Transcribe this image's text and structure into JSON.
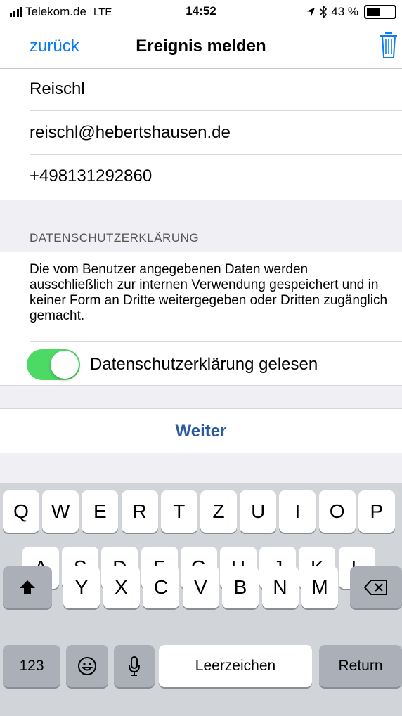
{
  "status_bar": {
    "carrier": "Telekom.de",
    "network": "LTE",
    "time": "14:52",
    "battery": "43 %",
    "battery_fraction": 0.43
  },
  "nav": {
    "back_label": "zurück",
    "title": "Ereignis melden"
  },
  "fields": {
    "name": "Reischl",
    "email": "reischl@hebertshausen.de",
    "phone": "+498131292860"
  },
  "privacy": {
    "header": "DATENSCHUTZERKLÄRUNG",
    "text": "Die vom Benutzer angegebenen Daten werden ausschließlich zur internen Verwendung gespeichert und in keiner Form an Dritte weitergegeben oder Dritten zugänglich gemacht.",
    "toggle_label": "Datenschutzerklärung gelesen",
    "toggle_on": true
  },
  "actions": {
    "next_label": "Weiter"
  },
  "keyboard": {
    "row1": [
      "Q",
      "W",
      "E",
      "R",
      "T",
      "Z",
      "U",
      "I",
      "O",
      "P"
    ],
    "row2": [
      "A",
      "S",
      "D",
      "F",
      "G",
      "H",
      "J",
      "K",
      "L"
    ],
    "row3": [
      "Y",
      "X",
      "C",
      "V",
      "B",
      "N",
      "M"
    ],
    "numbers_label": "123",
    "space_label": "Leerzeichen",
    "return_label": "Return"
  },
  "colors": {
    "accent_blue": "#0a7cf5",
    "toggle_green": "#4cd964",
    "next_blue": "#2c5aa0"
  }
}
